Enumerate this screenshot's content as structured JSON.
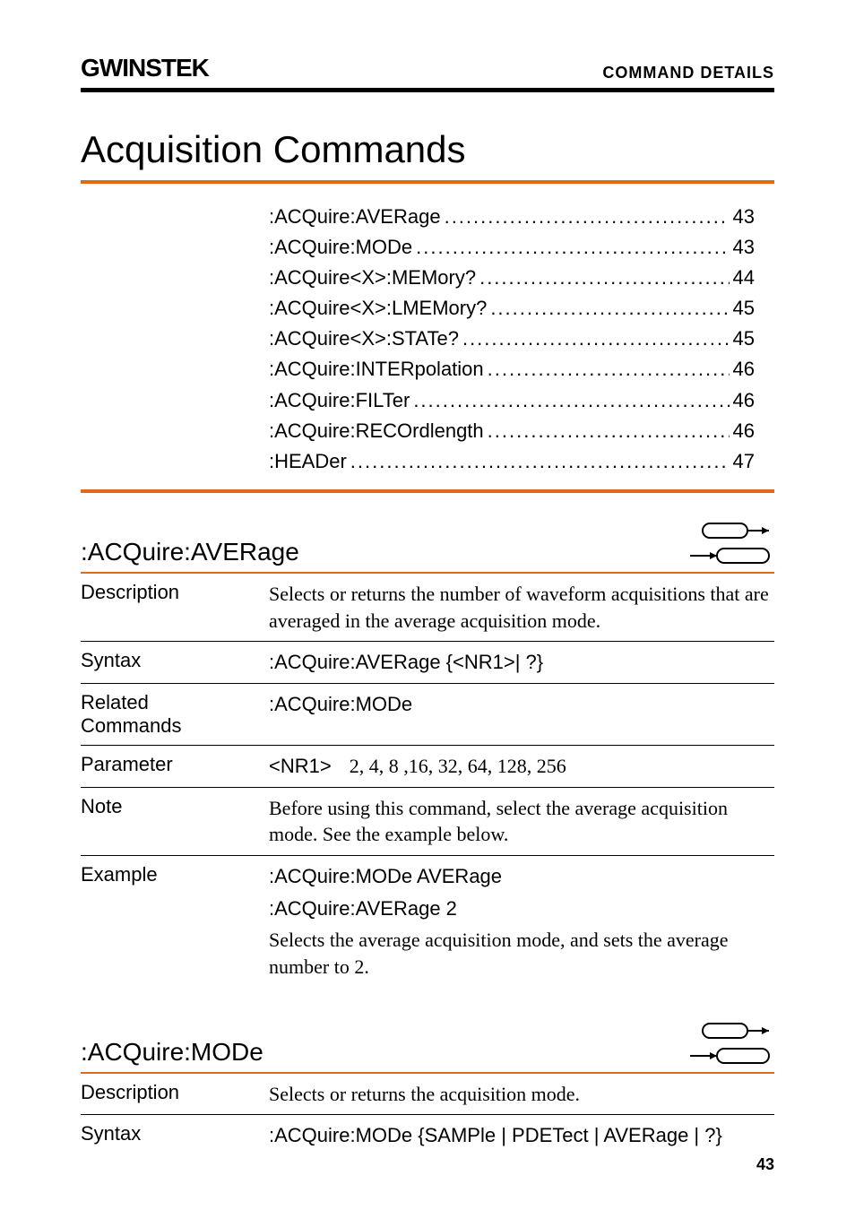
{
  "header": {
    "brand": "GWINSTEK",
    "section_label": "COMMAND DETAILS"
  },
  "title": "Acquisition Commands",
  "toc": [
    {
      "label": ":ACQuire:AVERage",
      "page": "43"
    },
    {
      "label": ":ACQuire:MODe",
      "page": "43"
    },
    {
      "label": ":ACQuire<X>:MEMory?",
      "page": "44"
    },
    {
      "label": ":ACQuire<X>:LMEMory?",
      "page": "45"
    },
    {
      "label": ":ACQuire<X>:STATe?",
      "page": "45"
    },
    {
      "label": ":ACQuire:INTERpolation",
      "page": "46"
    },
    {
      "label": ":ACQuire:FILTer",
      "page": "46"
    },
    {
      "label": ":ACQuire:RECOrdlength",
      "page": "46"
    },
    {
      "label": ":HEADer",
      "page": "47"
    }
  ],
  "sections": {
    "average": {
      "heading": ":ACQuire:AVERage",
      "description_label": "Description",
      "description": "Selects or returns the number of waveform acquisitions that are averaged in the average acquisition mode.",
      "syntax_label": "Syntax",
      "syntax": ":ACQuire:AVERage {<NR1>| ?}",
      "related_label_1": "Related",
      "related_label_2": "Commands",
      "related_value": ":ACQuire:MODe",
      "parameter_label": "Parameter",
      "parameter_key": "<NR1>",
      "parameter_values": "2, 4, 8 ,16, 32, 64, 128, 256",
      "note_label": "Note",
      "note": "Before using this command, select the average acquisition mode. See the example below.",
      "example_label": "Example",
      "example_line1": ":ACQuire:MODe AVERage",
      "example_line2": ":ACQuire:AVERage 2",
      "example_desc": "Selects the average acquisition mode, and sets the average number to 2."
    },
    "mode": {
      "heading": ":ACQuire:MODe",
      "description_label": "Description",
      "description": "Selects or returns the acquisition mode.",
      "syntax_label": "Syntax",
      "syntax": ":ACQuire:MODe {SAMPle | PDETect | AVERage | ?}"
    }
  },
  "page_number": "43"
}
